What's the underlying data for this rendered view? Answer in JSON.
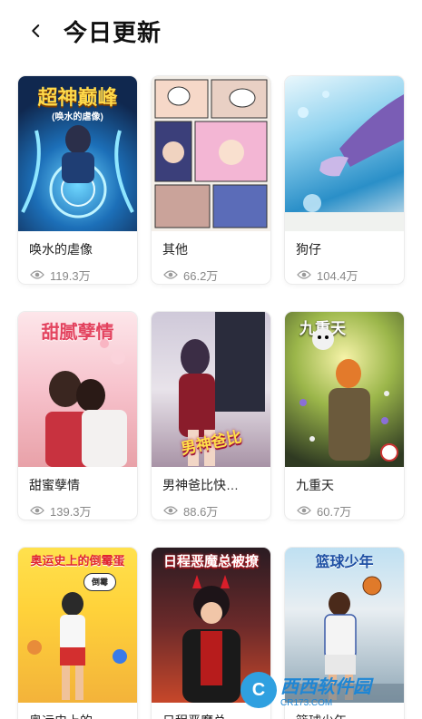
{
  "header": {
    "title": "今日更新"
  },
  "items": [
    {
      "name": "唤水的虐像",
      "views": "119.3万",
      "cover_title": "超神巅峰",
      "cover_subtitle": "(唤水的虐像)"
    },
    {
      "name": "其他",
      "views": "66.2万",
      "cover_title": "",
      "cover_subtitle": ""
    },
    {
      "name": "狗仔",
      "views": "104.4万",
      "cover_title": "",
      "cover_subtitle": ""
    },
    {
      "name": "甜蜜孽情",
      "views": "139.3万",
      "cover_title": "甜腻孽情",
      "cover_subtitle": ""
    },
    {
      "name": "男神爸比快…",
      "views": "88.6万",
      "cover_title": "男神爸比",
      "cover_subtitle": ""
    },
    {
      "name": "九重天",
      "views": "60.7万",
      "cover_title": "九重天",
      "cover_subtitle": ""
    },
    {
      "name": "奥运史上的",
      "views": "",
      "cover_title": "奥运史上的倒霉蛋",
      "cover_subtitle": "倒霉"
    },
    {
      "name": "日程恶魔总",
      "views": "",
      "cover_title": "日程恶魔总被撩",
      "cover_subtitle": ""
    },
    {
      "name": "篮球少年",
      "views": "",
      "cover_title": "篮球少年",
      "cover_subtitle": ""
    }
  ],
  "watermark": {
    "main": "西西软件园",
    "sub": "CR173.COM"
  },
  "colors": {
    "background": "#ffffff",
    "text": "#222222",
    "muted": "#888888"
  }
}
